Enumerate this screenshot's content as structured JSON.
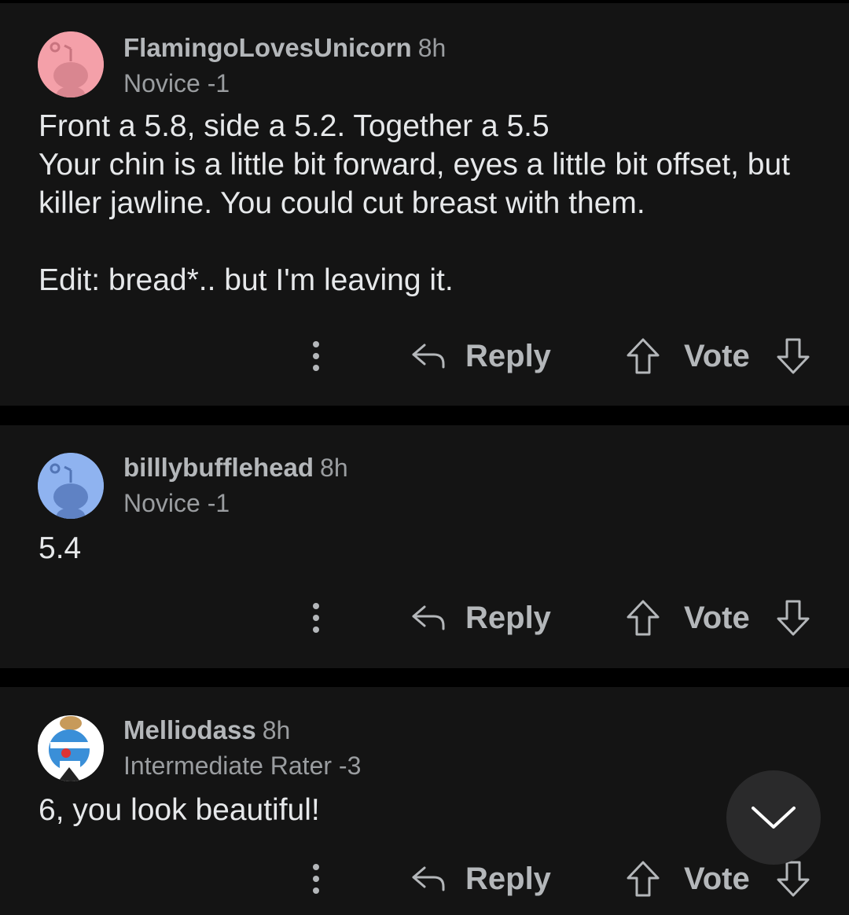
{
  "comments": [
    {
      "username": "FlamingoLovesUnicorn",
      "age": "8h",
      "flair": "Novice -1",
      "avatar_color": "#f4a0a9",
      "avatar_icon": "reddit-snoo-avatar",
      "body": "Front a 5.8, side a 5.2. Together a 5.5\nYour chin is a little bit forward, eyes a little bit offset, but killer jawline. You could cut breast with them.\n\nEdit: bread*.. but I'm leaving it.",
      "reply_label": "Reply",
      "vote_label": "Vote"
    },
    {
      "username": "billlybufflehead",
      "age": "8h",
      "flair": "Novice -1",
      "avatar_color": "#8fb3f0",
      "avatar_icon": "reddit-snoo-avatar",
      "body": "5.4",
      "reply_label": "Reply",
      "vote_label": "Vote"
    },
    {
      "username": "Melliodass",
      "age": "8h",
      "flair": "Intermediate Rater -3",
      "avatar_color": "#ffffff",
      "avatar_icon": "custom-character-avatar",
      "body": "6, you look beautiful!",
      "reply_label": "Reply",
      "vote_label": "Vote"
    }
  ],
  "fab_icon": "chevron-down-icon"
}
